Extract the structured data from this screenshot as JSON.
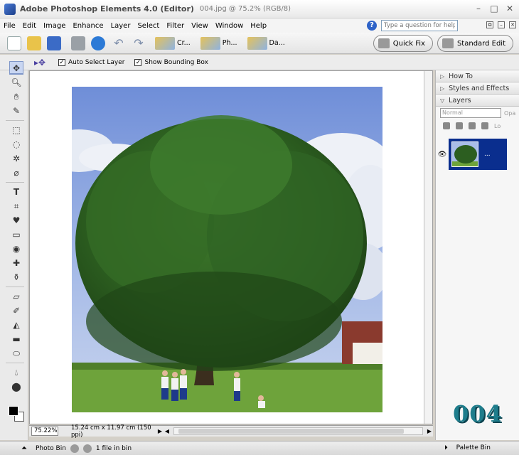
{
  "title": {
    "app": "Adobe Photoshop Elements 4.0 (Editor)",
    "file": "004.jpg @ 75.2% (RGB/8)"
  },
  "menu": [
    "File",
    "Edit",
    "Image",
    "Enhance",
    "Layer",
    "Select",
    "Filter",
    "View",
    "Window",
    "Help"
  ],
  "help": {
    "placeholder": "Type a question for help"
  },
  "shortcuts": {
    "create": "Cr...",
    "photo": "Ph...",
    "date": "Da..."
  },
  "modes": {
    "quick_fix": "Quick Fix",
    "standard_edit": "Standard Edit"
  },
  "options": {
    "auto_select": "Auto Select Layer",
    "bounding_box": "Show Bounding Box"
  },
  "status": {
    "zoom": "75.22%",
    "doc_info": "15.24 cm x 11.97 cm (150 ppi)"
  },
  "panels": {
    "how_to": "How To",
    "styles": "Styles and Effects",
    "layers": "Layers",
    "blend_mode": "Normal",
    "opacity_label": "Opa",
    "lock_label": "Lo",
    "layer_name": "..."
  },
  "watermark": "004",
  "bottom": {
    "photo_bin": "Photo Bin",
    "bin_count": "1 file in bin",
    "palette_bin": "Palette Bin"
  },
  "colors": {
    "selected_layer": "#0a2e8e",
    "watermark": "#1e7d8c"
  }
}
